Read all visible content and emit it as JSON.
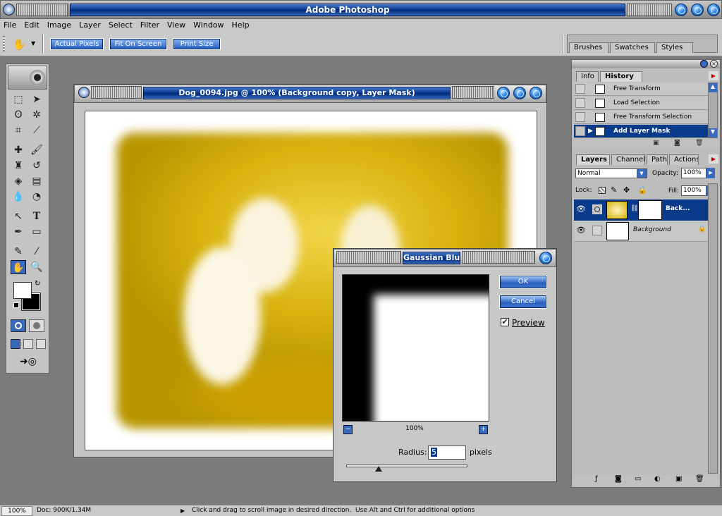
{
  "app": {
    "title": "Adobe Photoshop"
  },
  "menu": [
    "File",
    "Edit",
    "Image",
    "Layer",
    "Select",
    "Filter",
    "View",
    "Window",
    "Help"
  ],
  "options": {
    "actual_pixels": "Actual Pixels",
    "fit_on_screen": "Fit On Screen",
    "print_size": "Print Size"
  },
  "palette_well": [
    "Brushes",
    "Swatches",
    "Styles"
  ],
  "document": {
    "title": "Dog_0094.jpg @ 100% (Background copy, Layer Mask)"
  },
  "history": {
    "tabs": [
      "Info",
      "History"
    ],
    "items": [
      "Free Transform",
      "Load Selection",
      "Free Transform Selection",
      "Add Layer Mask"
    ]
  },
  "layers": {
    "tabs": [
      "Layers",
      "Channels",
      "Paths",
      "Actions"
    ],
    "blend_mode": "Normal",
    "opacity_label": "Opacity:",
    "opacity": "100%",
    "lock_label": "Lock:",
    "fill_label": "Fill:",
    "fill": "100%",
    "items": [
      "Back...",
      "Background"
    ]
  },
  "gaussian": {
    "title": "Gaussian Blur",
    "ok": "OK",
    "cancel": "Cancel",
    "preview_label": "Preview",
    "preview_checked": true,
    "zoom": "100%",
    "radius_label": "Radius:",
    "radius_value": "5",
    "radius_unit": "pixels"
  },
  "status": {
    "zoom": "100%",
    "doc": "Doc: 900K/1.34M",
    "hint": "Click and drag to scroll image in desired direction.  Use Alt and Ctrl for additional options"
  }
}
